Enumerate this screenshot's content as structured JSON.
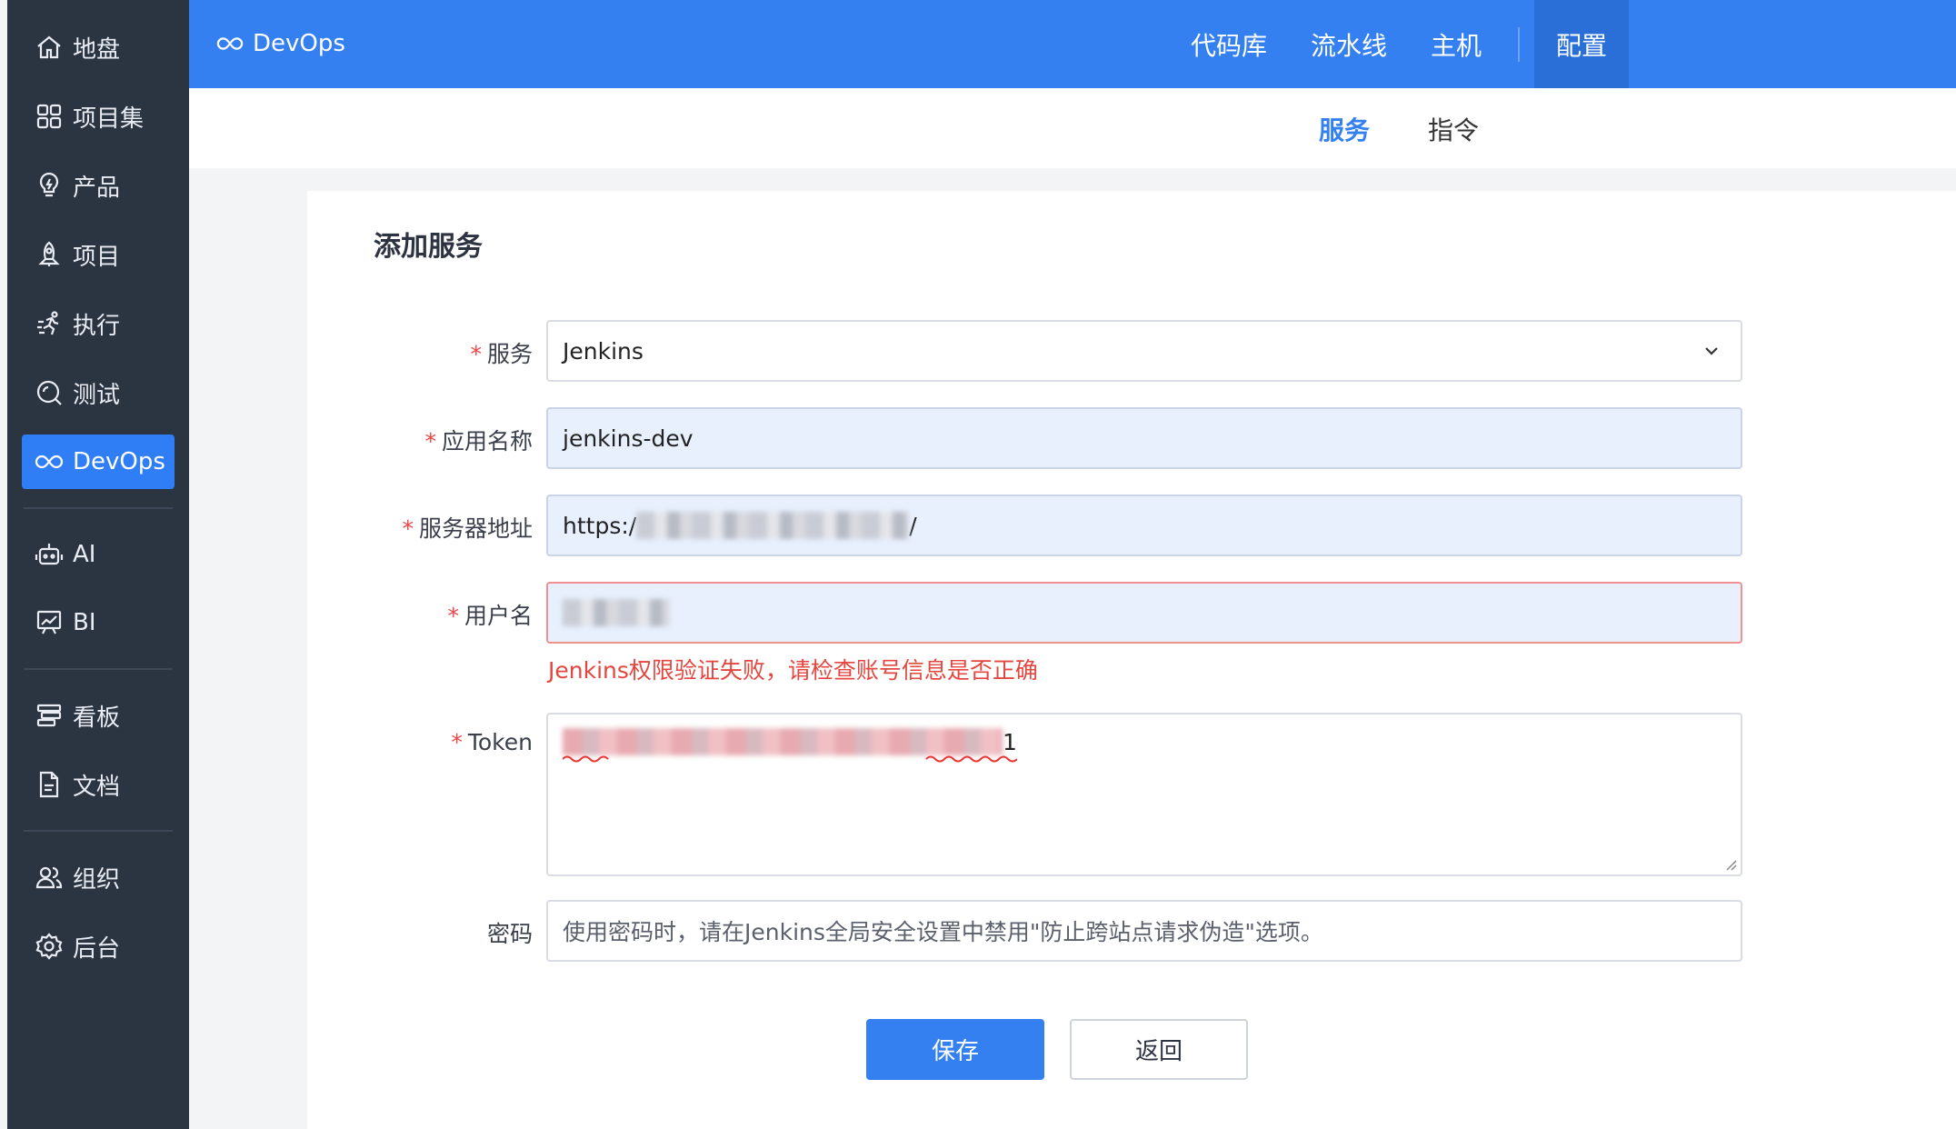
{
  "sidebar": {
    "items": [
      {
        "label": "地盘",
        "icon": "home-icon"
      },
      {
        "label": "项目集",
        "icon": "grid-icon"
      },
      {
        "label": "产品",
        "icon": "lightbulb-icon"
      },
      {
        "label": "项目",
        "icon": "rocket-icon"
      },
      {
        "label": "执行",
        "icon": "run-icon"
      },
      {
        "label": "测试",
        "icon": "search-icon"
      },
      {
        "label": "DevOps",
        "icon": "infinity-icon",
        "active": true
      },
      {
        "label": "AI",
        "icon": "robot-icon"
      },
      {
        "label": "BI",
        "icon": "chart-board-icon"
      },
      {
        "label": "看板",
        "icon": "kanban-icon"
      },
      {
        "label": "文档",
        "icon": "document-icon"
      },
      {
        "label": "组织",
        "icon": "users-icon"
      },
      {
        "label": "后台",
        "icon": "gear-icon"
      }
    ]
  },
  "header": {
    "brand": "DevOps",
    "nav": [
      "代码库",
      "流水线",
      "主机",
      "配置"
    ],
    "active_nav": "配置"
  },
  "subnav": {
    "tabs": [
      "服务",
      "指令"
    ],
    "active_tab": "服务"
  },
  "form": {
    "title": "添加服务",
    "required_mark": "*",
    "service_label": "服务",
    "service_value": "Jenkins",
    "app_name_label": "应用名称",
    "app_name_value": "jenkins-dev",
    "server_label": "服务器地址",
    "server_value_prefix": "https:/",
    "server_value_suffix": "/",
    "username_label": "用户名",
    "username_error": "Jenkins权限验证失败，请检查账号信息是否正确",
    "token_label": "Token",
    "token_value_suffix": "1",
    "password_label": "密码",
    "password_placeholder": "使用密码时，请在Jenkins全局安全设置中禁用\"防止跨站点请求伪造\"选项。",
    "save_label": "保存",
    "back_label": "返回"
  },
  "colors": {
    "accent": "#3580f0",
    "sidebar_bg": "#2b3441",
    "error": "#e4473f"
  }
}
